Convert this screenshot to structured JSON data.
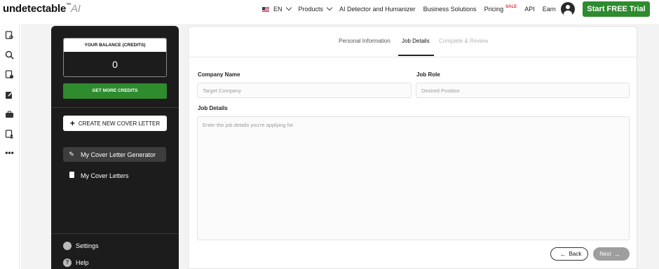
{
  "brand": {
    "name": "undetectable",
    "tm": "™",
    "suffix": "AI"
  },
  "topnav": {
    "language": "EN",
    "links": [
      "Products",
      "AI Detector and Humanizer",
      "Business Solutions",
      "Pricing",
      "API",
      "Earn"
    ],
    "sale_badge": "SALE",
    "cta_label": "Start FREE Trial"
  },
  "rail": {
    "icons": [
      "doc-search-icon",
      "magnifier-icon",
      "doc-check-icon",
      "edit-icon",
      "briefcase-icon",
      "doc-user-icon",
      "more-icon"
    ]
  },
  "sidebar": {
    "balance_label": "YOUR BALANCE (CREDITS)",
    "balance_value": "0",
    "get_credits_label": "GET MORE CREDITS",
    "new_cover_letter_label": "CREATE NEW COVER LETTER",
    "items": [
      {
        "label": "My Cover Letter Generator",
        "icon": "pencil-icon",
        "active": true
      },
      {
        "label": "My Cover Letters",
        "icon": "document-icon",
        "active": false
      }
    ],
    "settings_label": "Settings",
    "help_label": "Help"
  },
  "form": {
    "tabs": [
      {
        "label": "Personal Information",
        "state": "normal"
      },
      {
        "label": "Job Details",
        "state": "active"
      },
      {
        "label": "Complete & Review",
        "state": "disabled"
      }
    ],
    "company_label": "Company Name",
    "company_placeholder": "Target Company",
    "role_label": "Job Role",
    "role_placeholder": "Desired Position",
    "details_label": "Job Details",
    "details_placeholder": "Enter the job details you're applying for",
    "back_label": "Back",
    "next_label": "Next"
  },
  "colors": {
    "accent_green": "#2e8b2e",
    "sidebar_bg": "#1c1c1c",
    "sale_red": "#e03131"
  }
}
